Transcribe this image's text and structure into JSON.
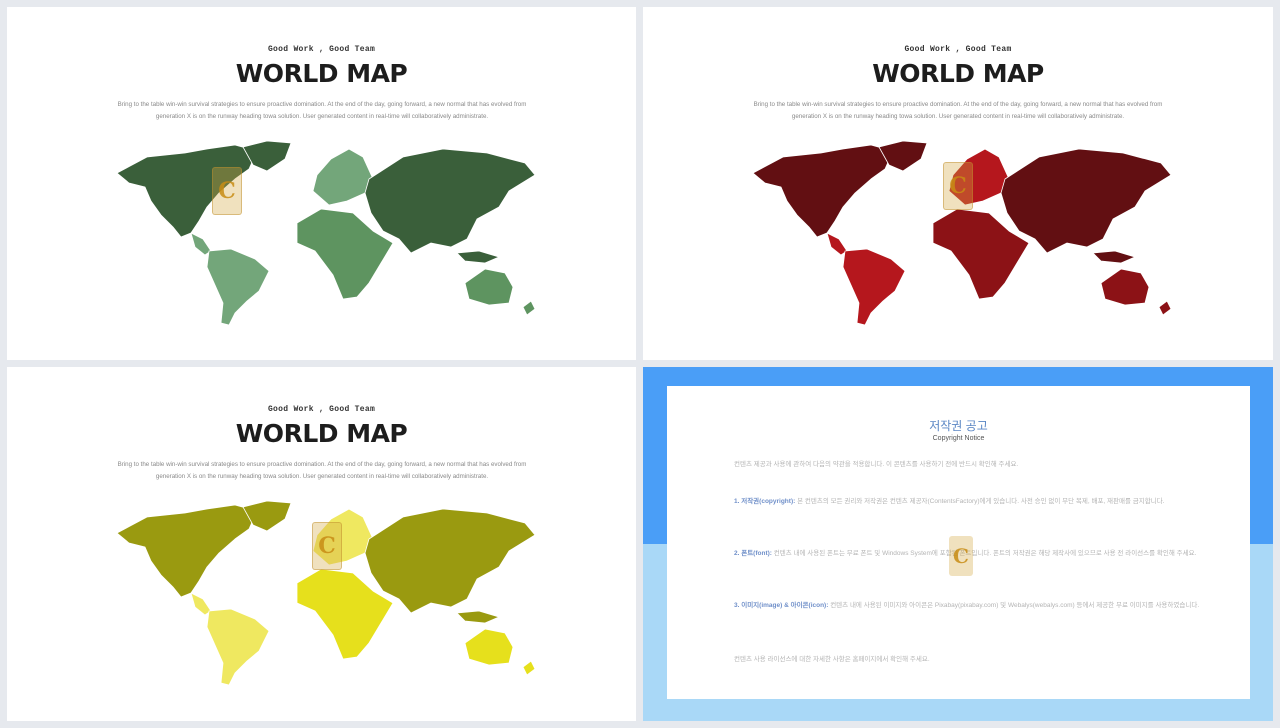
{
  "slides": [
    {
      "eyebrow": "Good Work , Good Team",
      "title": "WORLD MAP",
      "body_line1": "Bring to the table win-win survival strategies to ensure proactive domination. At the end of the day, going forward, a new normal that has evolved from",
      "body_line2": "generation X is on the runway heading towa solution. User generated content  in real-time will collaboratively administrate.",
      "colors": {
        "dark": "#3a5f3a",
        "mid": "#5e9460",
        "light": "#73a67a"
      }
    },
    {
      "eyebrow": "Good Work , Good Team",
      "title": "WORLD MAP",
      "body_line1": "Bring to the table win-win survival strategies to ensure proactive domination. At the end of the day, going forward, a new normal that has evolved from",
      "body_line2": "generation X is on the runway heading towa solution. User generated content  in real-time will collaboratively administrate.",
      "colors": {
        "dark": "#620f12",
        "mid": "#8c1216",
        "light": "#b5171d"
      }
    },
    {
      "eyebrow": "Good Work , Good Team",
      "title": "WORLD MAP",
      "body_line1": "Bring to the table win-win survival strategies to ensure proactive domination. At the end of the day, going forward, a new normal that has evolved from",
      "body_line2": "generation X is on the runway heading towa solution. User generated content  in real-time will collaboratively administrate.",
      "colors": {
        "dark": "#9a9a10",
        "mid": "#e6e01c",
        "light": "#efe860"
      }
    }
  ],
  "stamp_letter": "C",
  "copyright": {
    "title": "저작권 공고",
    "subtitle": "Copyright Notice",
    "intro": "컨텐츠 제공과 사용에 관하여 다음의 약관을 적용합니다. 이 콘텐츠를 사용하기 전에 반드시 확인해 주세요.",
    "p1_head": "1. 저작권(copyright):",
    "p1_body": " 본 컨텐츠의 모든 권리와 저작권은 컨텐츠 제공자(ContentsFactory)에게 있습니다. 사전 승인 없이 무단 복제, 배포, 재판매를 금지합니다.",
    "p2_head": "2. 폰트(font):",
    "p2_body": " 컨텐츠 내에 사용된 폰트는 무료 폰트 및 Windows System에 포함된 폰트입니다. 폰트의 저작권은 해당 제작사에 있으므로 사용 전 라이선스를 확인해 주세요.",
    "p3_head": "3. 이미지(image) & 아이콘(icon):",
    "p3_body": " 컨텐츠 내에 사용된 이미지와 아이콘은 Pixabay(pixabay.com) 및 Webalys(webalys.com) 등에서 제공한 무료 이미지를 사용하였습니다.",
    "footer": "컨텐츠 사용 라이선스에 대한 자세한 사항은 홈페이지에서 확인해 주세요."
  }
}
